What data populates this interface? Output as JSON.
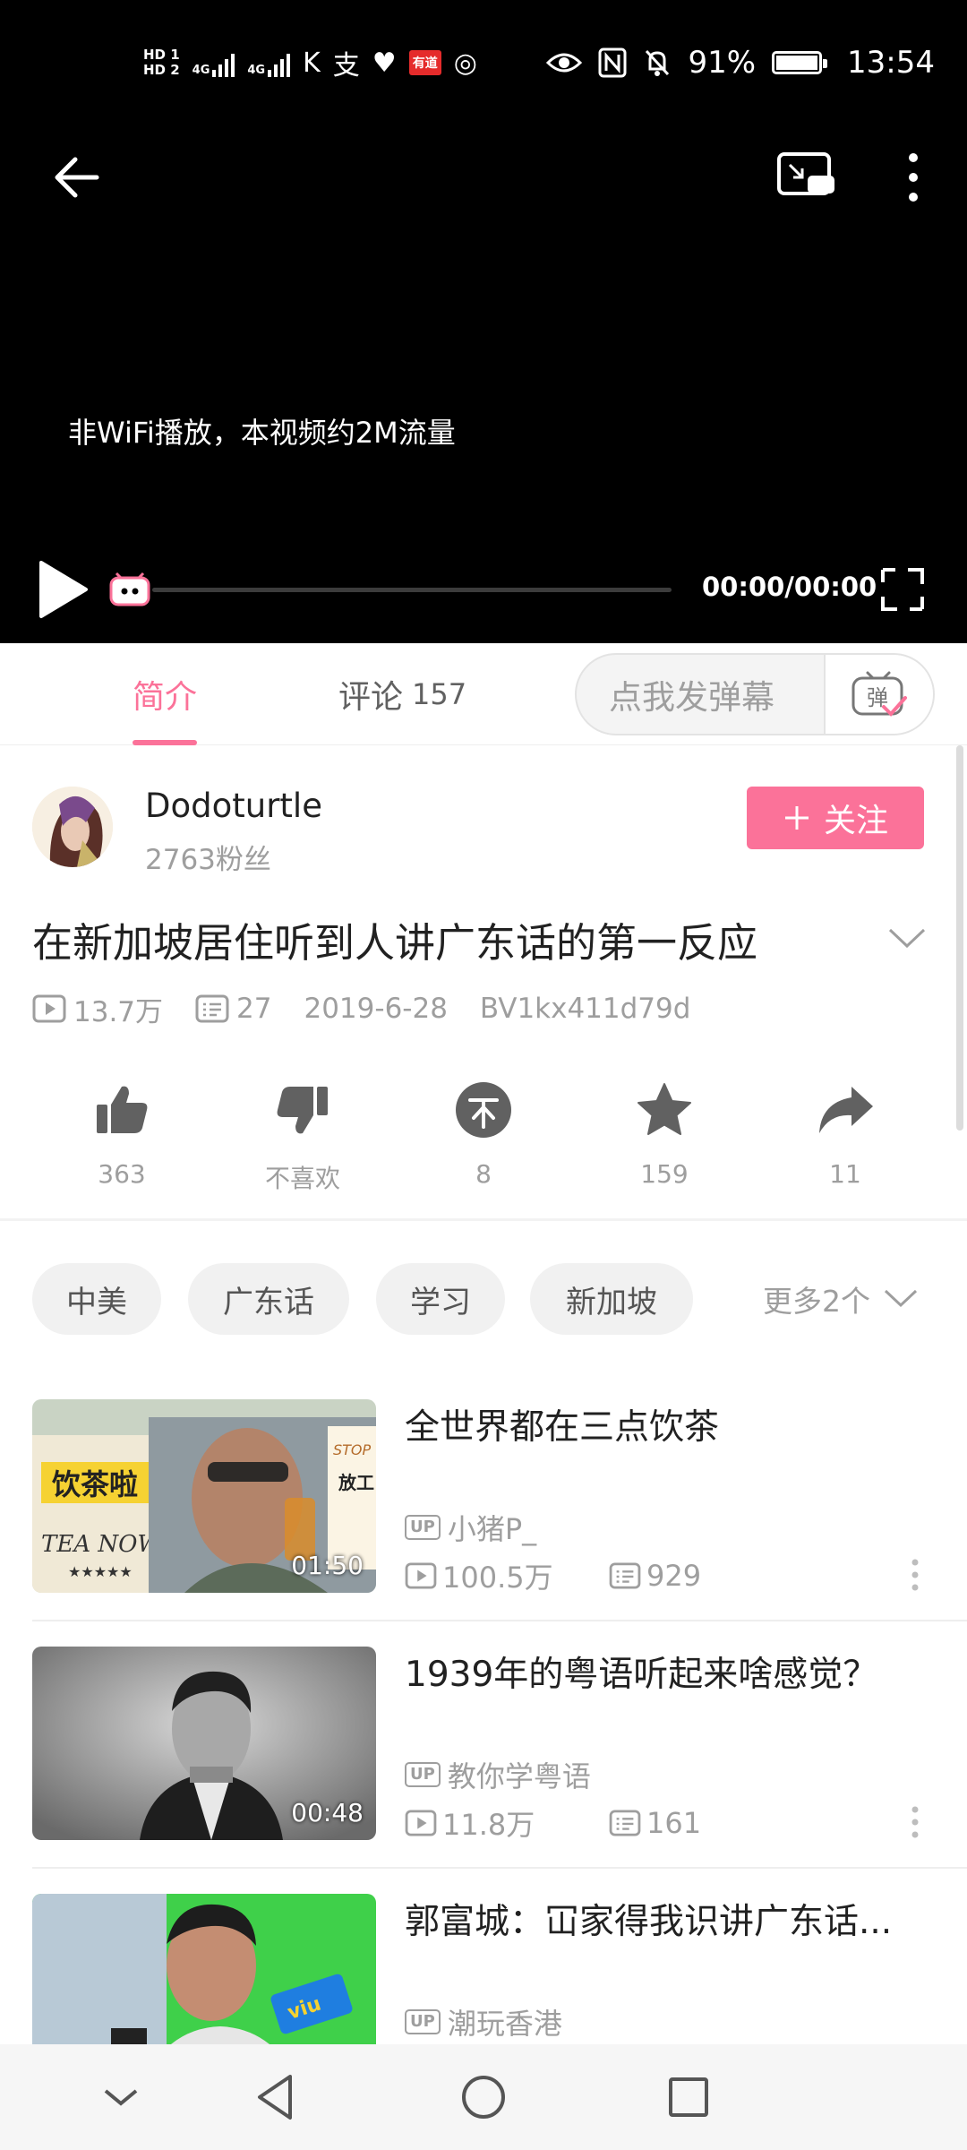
{
  "status_bar": {
    "hd1": "HD 1",
    "hd2": "HD 2",
    "network1": "4G",
    "network2": "4G",
    "notif_tag": "有道",
    "battery_percent": "91%",
    "battery_level": 0.91,
    "time": "13:54"
  },
  "player": {
    "notice": "非WiFi播放，本视频约2M流量",
    "time": "00:00/00:00",
    "progress": 0
  },
  "tabs": {
    "intro": "简介",
    "comments": "评论",
    "comments_count": "157",
    "danmaku_placeholder": "点我发弹幕",
    "danmaku_button": "弹"
  },
  "uploader": {
    "name": "Dodoturtle",
    "fans": "2763粉丝",
    "follow": "关注"
  },
  "video": {
    "title": "在新加坡居住听到人讲广东话的第一反应",
    "views": "13.7万",
    "danmaku": "27",
    "date": "2019-6-28",
    "bvid": "BV1kx411d79d"
  },
  "actions": [
    {
      "icon": "thumbs-up-icon",
      "label": "363"
    },
    {
      "icon": "thumbs-down-icon",
      "label": "不喜欢"
    },
    {
      "icon": "coin-icon",
      "label": "8"
    },
    {
      "icon": "star-icon",
      "label": "159"
    },
    {
      "icon": "share-icon",
      "label": "11"
    }
  ],
  "tags": [
    "中美",
    "广东话",
    "学习",
    "新加坡"
  ],
  "more_tags": "更多2个",
  "related": [
    {
      "title": "全世界都在三点饮茶",
      "uploader": "小猪P_",
      "views": "100.5万",
      "danmaku": "929",
      "duration": "01:50",
      "thumb_text1": "饮茶啦",
      "thumb_text2": "TEA NOW",
      "thumb_text3": "STOP",
      "thumb_text4": "放工"
    },
    {
      "title": "1939年的粤语听起来啥感觉？",
      "uploader": "教你学粤语",
      "views": "11.8万",
      "danmaku": "161",
      "duration": "00:48"
    },
    {
      "title": "郭富城：冚家得我识讲广东话...",
      "uploader": "潮玩香港"
    }
  ],
  "up_badge": "UP",
  "colors": {
    "accent": "#fb7299",
    "player_bg": "#000000",
    "meta_gray": "#9e9e9e"
  }
}
